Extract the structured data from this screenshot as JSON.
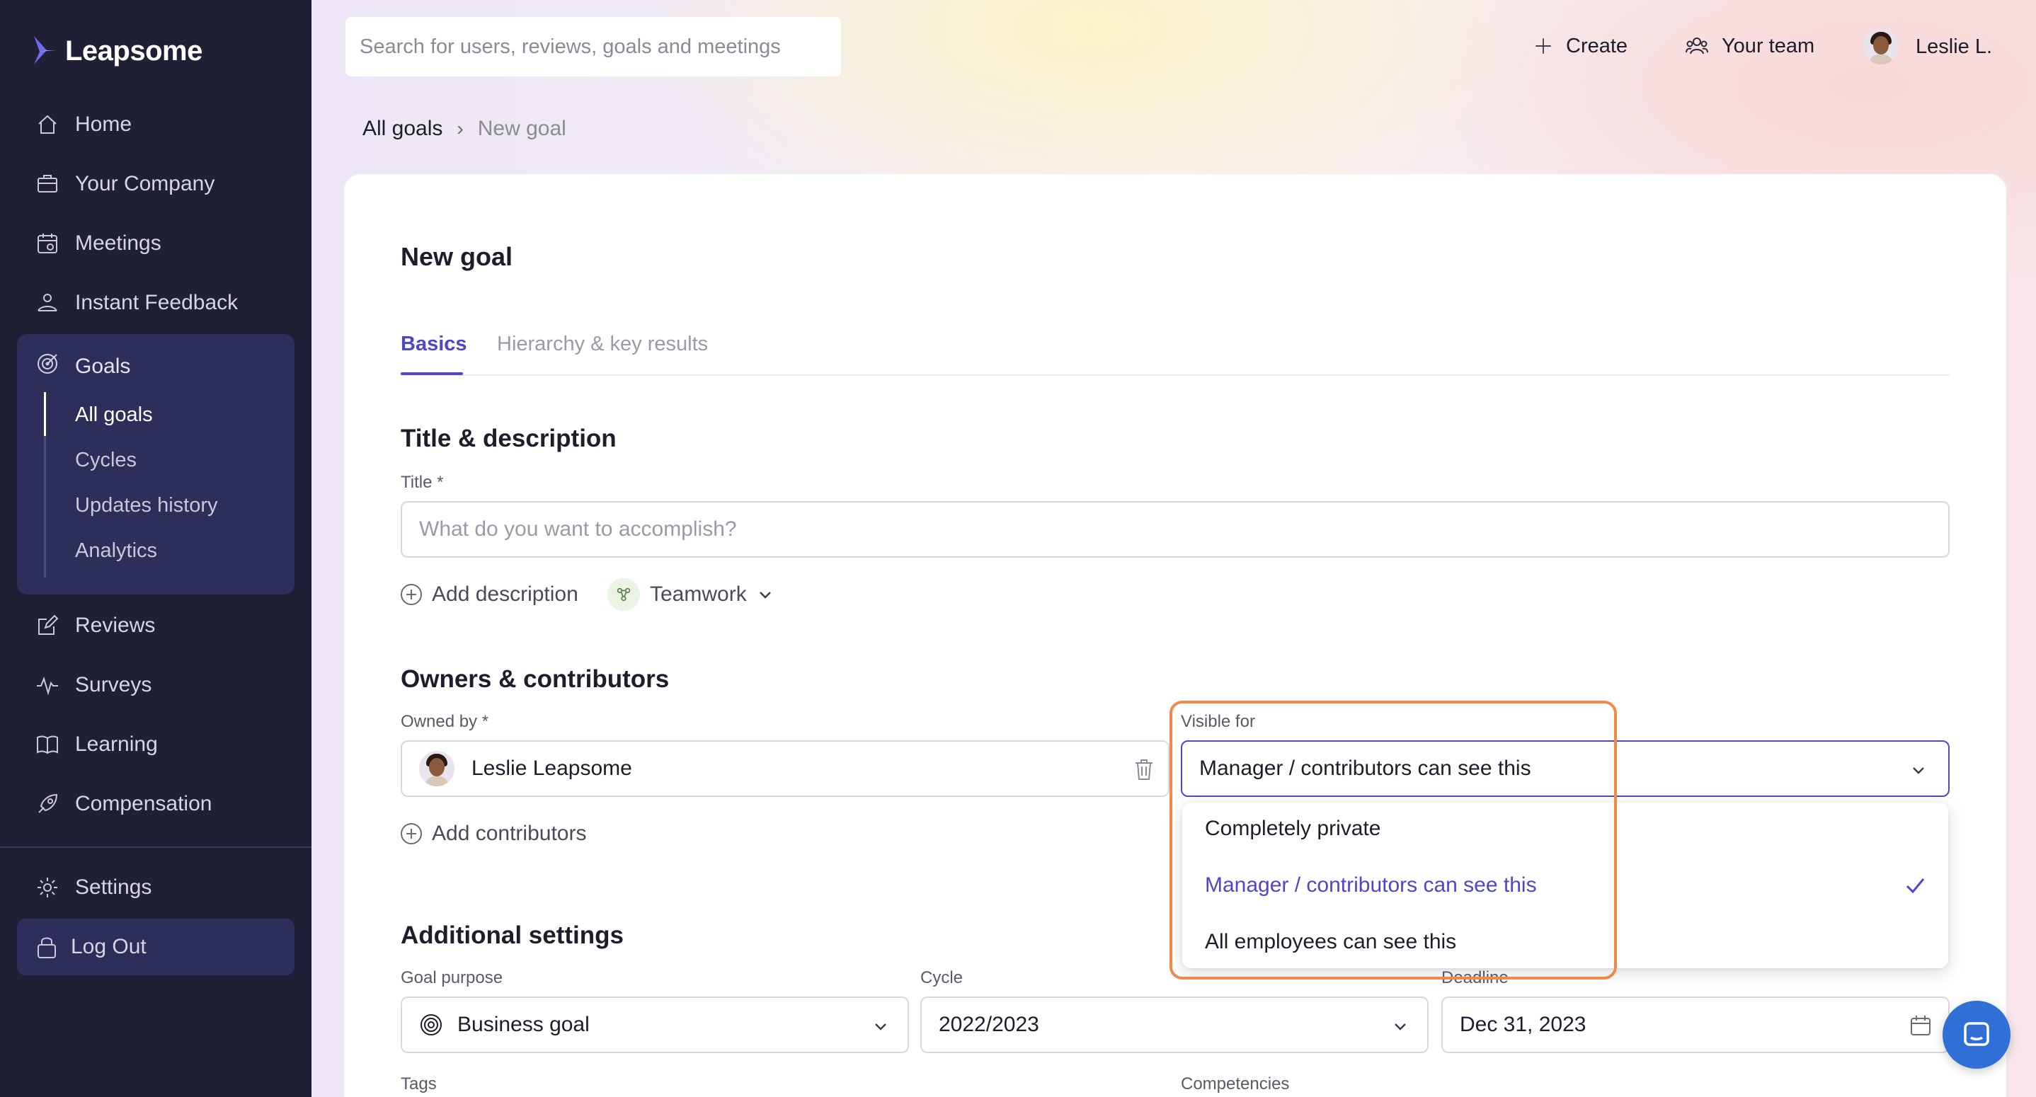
{
  "app": {
    "brand": "Leapsome"
  },
  "sidebar": {
    "items": [
      {
        "label": "Home",
        "icon": "home-icon"
      },
      {
        "label": "Your Company",
        "icon": "company-icon"
      },
      {
        "label": "Meetings",
        "icon": "meetings-icon"
      },
      {
        "label": "Instant Feedback",
        "icon": "feedback-icon"
      },
      {
        "label": "Goals",
        "icon": "goals-icon"
      },
      {
        "label": "Reviews",
        "icon": "reviews-icon"
      },
      {
        "label": "Surveys",
        "icon": "surveys-icon"
      },
      {
        "label": "Learning",
        "icon": "learning-icon"
      },
      {
        "label": "Compensation",
        "icon": "compensation-icon"
      },
      {
        "label": "Settings",
        "icon": "settings-icon"
      }
    ],
    "goals_sub": [
      "All goals",
      "Cycles",
      "Updates history",
      "Analytics"
    ],
    "logout": "Log Out"
  },
  "header": {
    "search_placeholder": "Search for users, reviews, goals and meetings",
    "create": "Create",
    "your_team": "Your team",
    "user": "Leslie L."
  },
  "breadcrumb": {
    "root": "All goals",
    "sep": "›",
    "current": "New goal"
  },
  "page": {
    "title": "New goal",
    "tabs": [
      "Basics",
      "Hierarchy & key results"
    ],
    "sections": {
      "title_desc": "Title & description",
      "owners": "Owners & contributors",
      "additional": "Additional settings"
    },
    "title_label": "Title *",
    "title_placeholder": "What do you want to accomplish?",
    "add_description": "Add description",
    "category": "Teamwork",
    "owned_by_label": "Owned by *",
    "owner": "Leslie Leapsome",
    "add_contributors": "Add contributors",
    "visible_for_label": "Visible for",
    "visible_for_value": "Manager / contributors can see this",
    "visibility_options": [
      "Completely private",
      "Manager / contributors can see this",
      "All employees can see this"
    ],
    "selected_option_index": 1,
    "goal_purpose_label": "Goal purpose",
    "goal_purpose": "Business goal",
    "cycle_label": "Cycle",
    "cycle": "2022/2023",
    "deadline_label": "Deadline",
    "deadline": "Dec 31, 2023",
    "tags_label": "Tags",
    "competencies_label": "Competencies"
  },
  "colors": {
    "accent": "#4f46c8",
    "sidebar_bg": "#1f2036",
    "highlight": "#f08a4b",
    "chat": "#2f6fd6"
  }
}
